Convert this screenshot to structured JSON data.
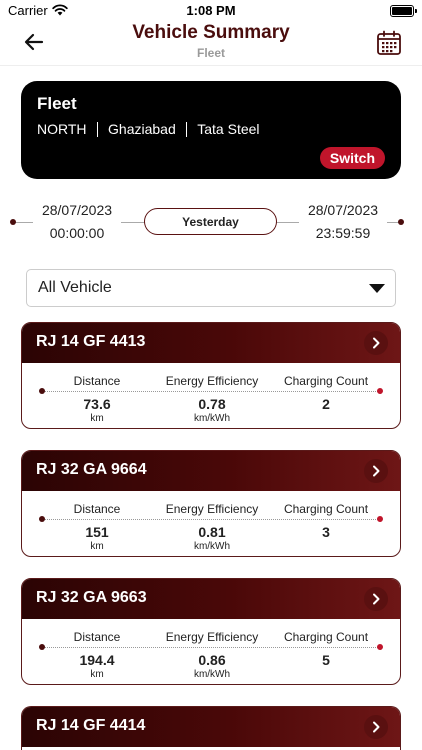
{
  "status_bar": {
    "carrier": "Carrier",
    "time": "1:08 PM"
  },
  "header": {
    "title": "Vehicle Summary",
    "subtitle": "Fleet"
  },
  "fleet_card": {
    "title": "Fleet",
    "region": "NORTH",
    "city": "Ghaziabad",
    "company": "Tata Steel",
    "switch_label": "Switch"
  },
  "date_range": {
    "start_date": "28/07/2023",
    "start_time": "00:00:00",
    "preset_label": "Yesterday",
    "end_date": "28/07/2023",
    "end_time": "23:59:59"
  },
  "vehicle_filter": {
    "selected": "All Vehicle"
  },
  "metric_labels": {
    "distance": "Distance",
    "efficiency": "Energy Efficiency",
    "charging": "Charging Count"
  },
  "vehicles": [
    {
      "plate": "RJ 14 GF 4413",
      "distance": "73.6",
      "distance_unit": "km",
      "efficiency": "0.78",
      "efficiency_unit": "km/kWh",
      "charging_count": "2"
    },
    {
      "plate": "RJ 32 GA 9664",
      "distance": "151",
      "distance_unit": "km",
      "efficiency": "0.81",
      "efficiency_unit": "km/kWh",
      "charging_count": "3"
    },
    {
      "plate": "RJ 32 GA 9663",
      "distance": "194.4",
      "distance_unit": "km",
      "efficiency": "0.86",
      "efficiency_unit": "km/kWh",
      "charging_count": "5"
    },
    {
      "plate": "RJ 14 GF 4414"
    }
  ],
  "colors": {
    "brand_dark": "#4a0d0d",
    "accent_red": "#c0152b",
    "card_black": "#000000"
  }
}
